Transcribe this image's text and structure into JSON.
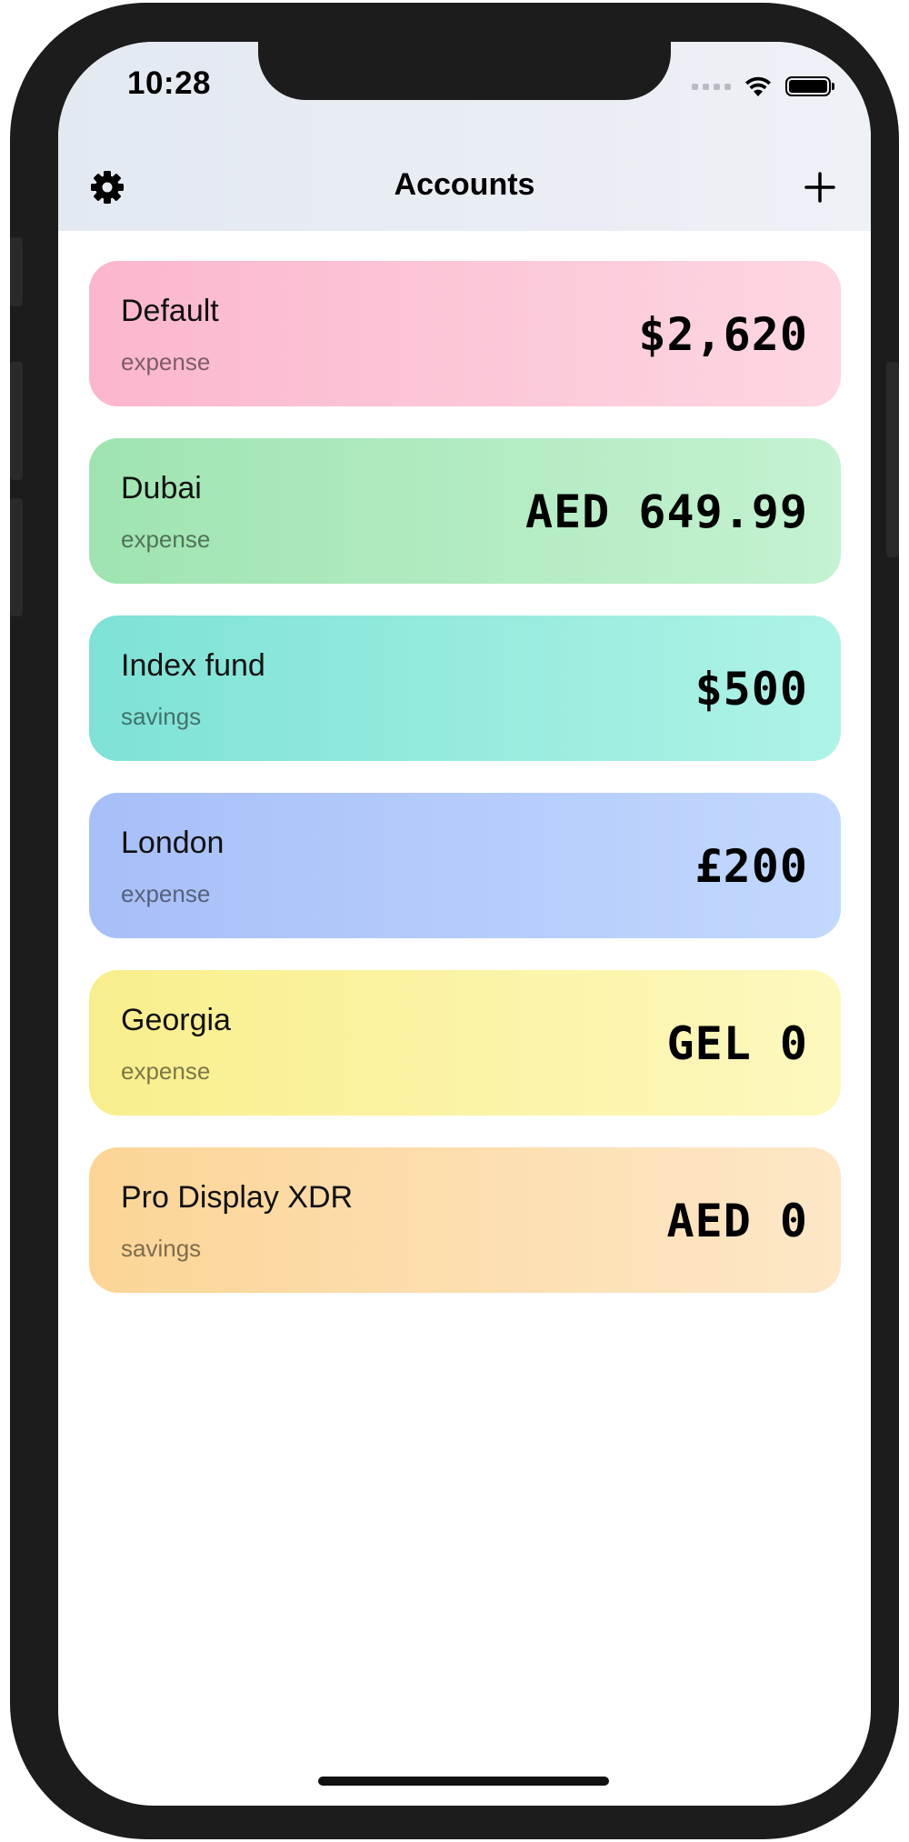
{
  "status_bar": {
    "time": "10:28"
  },
  "nav": {
    "title": "Accounts",
    "settings_icon": "gear-icon",
    "add_icon": "plus-icon"
  },
  "accounts": [
    {
      "name": "Default",
      "type": "expense",
      "amount": "$2,620",
      "gradient_start": "#fbb6cd",
      "gradient_end": "#fdd7e2"
    },
    {
      "name": "Dubai",
      "type": "expense",
      "amount": "AED 649.99",
      "gradient_start": "#9fe4b0",
      "gradient_end": "#c4f2d2"
    },
    {
      "name": "Index fund",
      "type": "savings",
      "amount": "$500",
      "gradient_start": "#7ee2d6",
      "gradient_end": "#aef3e6"
    },
    {
      "name": "London",
      "type": "expense",
      "amount": "£200",
      "gradient_start": "#a7bff8",
      "gradient_end": "#c2d8fe"
    },
    {
      "name": "Georgia",
      "type": "expense",
      "amount": "GEL 0",
      "gradient_start": "#f9ee8c",
      "gradient_end": "#fdf8be"
    },
    {
      "name": "Pro Display XDR",
      "type": "savings",
      "amount": "AED 0",
      "gradient_start": "#fcd596",
      "gradient_end": "#fde7c7"
    }
  ]
}
